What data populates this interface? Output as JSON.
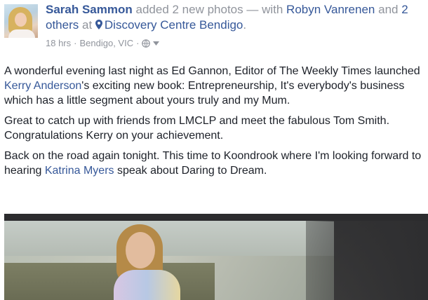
{
  "header": {
    "author": "Sarah Sammon",
    "action_text": "added 2 new photos — with",
    "tagged_person": "Robyn Vanrenen",
    "and_text": "and",
    "others": "2 others",
    "at_text": "at",
    "place": "Discovery Centre Bendigo",
    "place_suffix": "."
  },
  "meta": {
    "time": "18 hrs",
    "separator": "·",
    "location": "Bendigo, VIC",
    "separator2": "·"
  },
  "post": {
    "p1_before": "A wonderful evening last night as Ed Gannon, Editor of The Weekly Times launched ",
    "p1_link": "Kerry Anderson",
    "p1_after": "'s exciting new book: Entrepreneurship, It's everybody's business which has a little segment about yours truly and my Mum.",
    "p2": "Great to catch up with friends from LMCLP and meet the fabulous Tom Smith. Congratulations Kerry on your achievement.",
    "p3_before": "Back on the road again tonight. This time to Koondrook where I'm looking forward to hearing ",
    "p3_link": "Katrina Myers",
    "p3_after": " speak about Daring to Dream."
  },
  "icons": {
    "avatar": "profile-photo",
    "pin": "map-pin-icon",
    "globe": "globe-icon",
    "caret": "caret-down-icon"
  },
  "colors": {
    "link": "#365899",
    "meta": "#90949c",
    "text": "#1d2129"
  }
}
